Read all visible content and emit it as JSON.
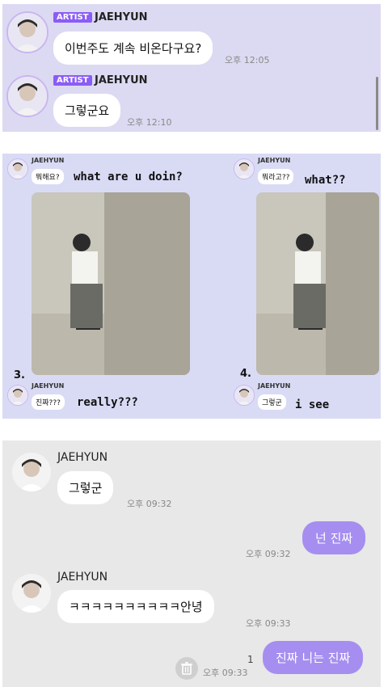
{
  "panel1": {
    "messages": [
      {
        "badge": "ARTIST",
        "sender": "JAEHYUN",
        "text": "이번주도 계속 비온다구요?",
        "time": "오후 12:05"
      },
      {
        "badge": "ARTIST",
        "sender": "JAEHYUN",
        "text": "그렇군요",
        "time": "오후 12:10"
      }
    ]
  },
  "panel2": {
    "frames": [
      {
        "number": "",
        "sender": "JAEHYUN",
        "bubble": "뭐해요?",
        "caption": "what are u doin?"
      },
      {
        "number": "",
        "sender": "JAEHYUN",
        "bubble": "뭐라고??",
        "caption": "what??"
      },
      {
        "number": "3.",
        "sender": "JAEHYUN",
        "bubble": "진짜???",
        "caption": "really???"
      },
      {
        "number": "4.",
        "sender": "JAEHYUN",
        "bubble": "그렇군",
        "caption": "i see"
      }
    ]
  },
  "panel3": {
    "messages": [
      {
        "sender": "JAEHYUN",
        "text": "그렇군",
        "time": "오후 09:32"
      },
      {
        "text": "넌 진짜",
        "time": "오후 09:32"
      },
      {
        "sender": "JAEHYUN",
        "text": "ㅋㅋㅋㅋㅋㅋㅋㅋㅋㅋ안녕",
        "time": "오후 09:33"
      },
      {
        "text": "진짜 니는 진짜",
        "time": "오후 09:33",
        "unread": "1"
      }
    ]
  },
  "colors": {
    "artist_badge": "#8b5cf6",
    "my_bubble": "#a68ef0",
    "panel1_bg": "#dcdaf2",
    "panel3_bg": "#e8e8e8"
  }
}
